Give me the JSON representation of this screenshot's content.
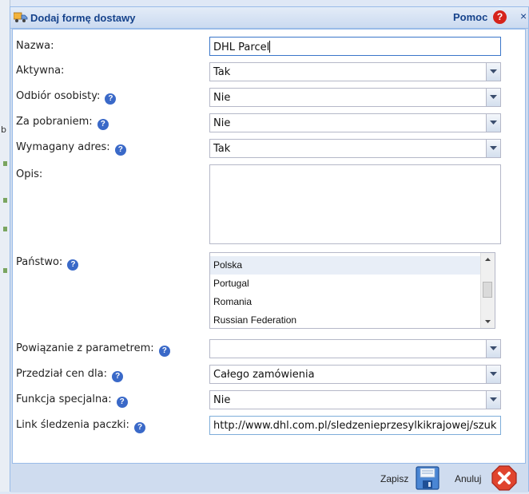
{
  "dialog": {
    "title": "Dodaj formę dostawy",
    "help_label": "Pomoc",
    "help_icon": "question-icon",
    "close_label": "×"
  },
  "form": {
    "name": {
      "label": "Nazwa:",
      "value": "DHL Parcel"
    },
    "active": {
      "label": "Aktywna:",
      "value": "Tak"
    },
    "pickup": {
      "label": "Odbiór osobisty:",
      "value": "Nie"
    },
    "cod": {
      "label": "Za pobraniem:",
      "value": "Nie"
    },
    "address_required": {
      "label": "Wymagany adres:",
      "value": "Tak"
    },
    "description": {
      "label": "Opis:",
      "value": ""
    },
    "country": {
      "label": "Państwo:",
      "options": [
        "Polska",
        "Portugal",
        "Romania",
        "Russian Federation"
      ],
      "selected": "Polska"
    },
    "parameter_link": {
      "label": "Powiązanie z parametrem:",
      "value": ""
    },
    "price_range": {
      "label": "Przedział cen dla:",
      "value": "Całego zamówienia"
    },
    "special_function": {
      "label": "Funkcja specjalna:",
      "value": "Nie"
    },
    "tracking_link": {
      "label": "Link śledzenia paczki:",
      "value": "http://www.dhl.com.pl/sledzenieprzesylkikrajowej/szukaj"
    }
  },
  "buttons": {
    "save": "Zapisz",
    "cancel": "Anuluj"
  },
  "colors": {
    "title_text": "#15428b",
    "help_icon": "#d6231b",
    "info_icon": "#3a69c8",
    "cancel_icon": "#e0442e"
  }
}
